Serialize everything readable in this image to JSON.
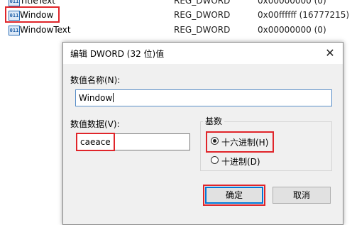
{
  "registry": {
    "rows": [
      {
        "name": "TitleText",
        "type": "REG_DWORD",
        "value": "0x00000000 (0)"
      },
      {
        "name": "Window",
        "type": "REG_DWORD",
        "value": "0x00ffffff (16777215)"
      },
      {
        "name": "WindowText",
        "type": "REG_DWORD",
        "value": "0x00000000 (0)"
      }
    ]
  },
  "dialog": {
    "title": "编辑 DWORD (32 位)值",
    "close_glyph": "✕",
    "name_label": "数值名称(N):",
    "name_value": "Window",
    "data_label": "数值数据(V):",
    "data_value": "caeace",
    "base_label": "基数",
    "base_options": [
      {
        "label": "十六进制(H)",
        "checked": true
      },
      {
        "label": "十进制(D)",
        "checked": false
      }
    ],
    "ok_label": "确定",
    "cancel_label": "取消"
  },
  "colors": {
    "highlight": "#e0252a",
    "accent": "#0078d7"
  }
}
